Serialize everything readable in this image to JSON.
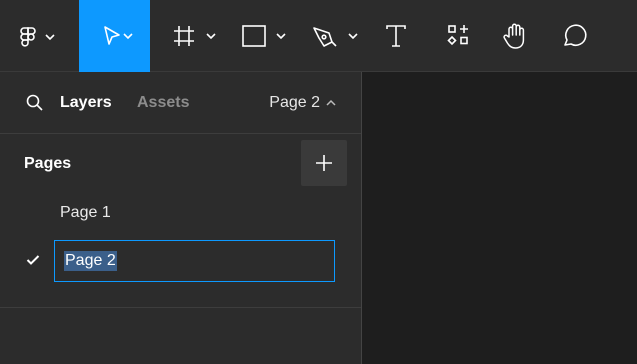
{
  "toolbar": {
    "tools": [
      {
        "name": "main-menu",
        "icon": "figma-logo-icon",
        "has_dropdown": true
      },
      {
        "name": "move",
        "icon": "cursor-arrow-icon",
        "has_dropdown": true,
        "active": true
      },
      {
        "name": "frame",
        "icon": "frame-hash-icon",
        "has_dropdown": true
      },
      {
        "name": "shape",
        "icon": "rectangle-icon",
        "has_dropdown": true
      },
      {
        "name": "pen",
        "icon": "pen-nib-icon",
        "has_dropdown": true
      },
      {
        "name": "text",
        "icon": "text-t-icon"
      },
      {
        "name": "resources",
        "icon": "components-grid-icon"
      },
      {
        "name": "hand",
        "icon": "hand-icon"
      },
      {
        "name": "comment",
        "icon": "speech-bubble-icon"
      }
    ],
    "active_color": "#0d99ff"
  },
  "panel": {
    "tabs": {
      "layers": "Layers",
      "assets": "Assets"
    },
    "current_page": "Page 2",
    "pages_title": "Pages",
    "pages": [
      {
        "label": "Page 1"
      },
      {
        "label": "Page 2",
        "selected": true,
        "editing": true
      }
    ]
  }
}
